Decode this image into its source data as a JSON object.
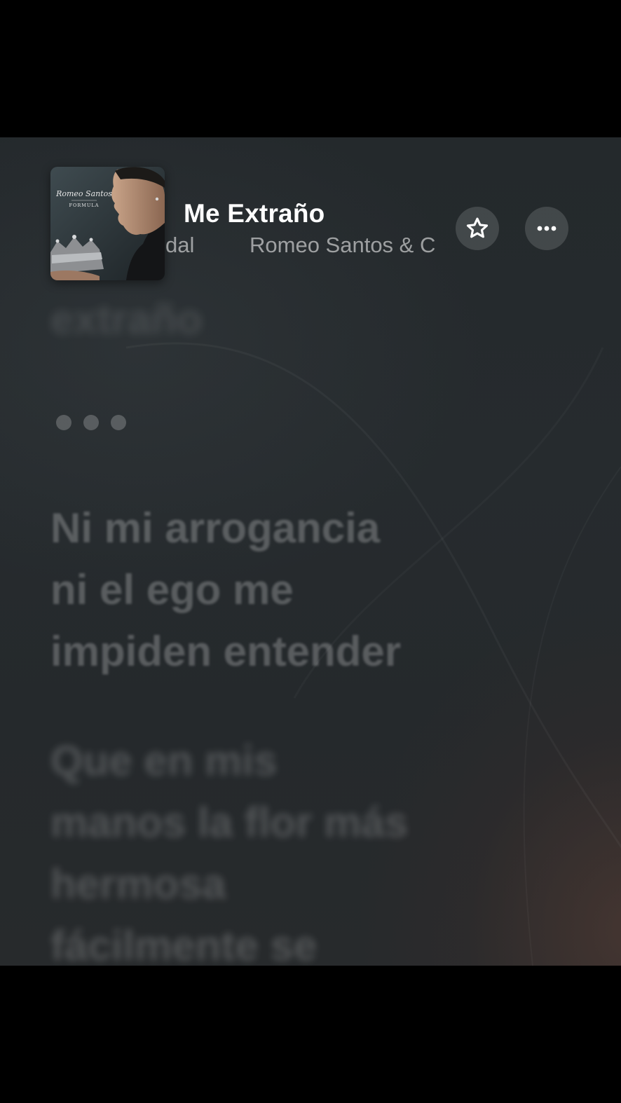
{
  "track": {
    "title": "Me Extraño",
    "subtitle_left": "dal",
    "artist": "Romeo Santos & C"
  },
  "album_art": {
    "artist_script": "Romeo Santos",
    "album_word": "FORMULA"
  },
  "buttons": {
    "favorite_icon": "star-outline-icon",
    "more_icon": "ellipsis-icon"
  },
  "lyrics": {
    "previous_line": "extraño",
    "instrumental_break": "•••",
    "verse1_line1": "Ni mi arrogancia",
    "verse1_line2": "ni el ego me",
    "verse1_line3": "impiden entender",
    "verse2_line1": "Que en mis",
    "verse2_line2": "manos la flor más",
    "verse2_line3": "hermosa",
    "verse2_line4": "fácilmente se"
  },
  "colors": {
    "background": "#25292c",
    "title": "#ffffff",
    "warm_glow": "#5c3e34"
  }
}
